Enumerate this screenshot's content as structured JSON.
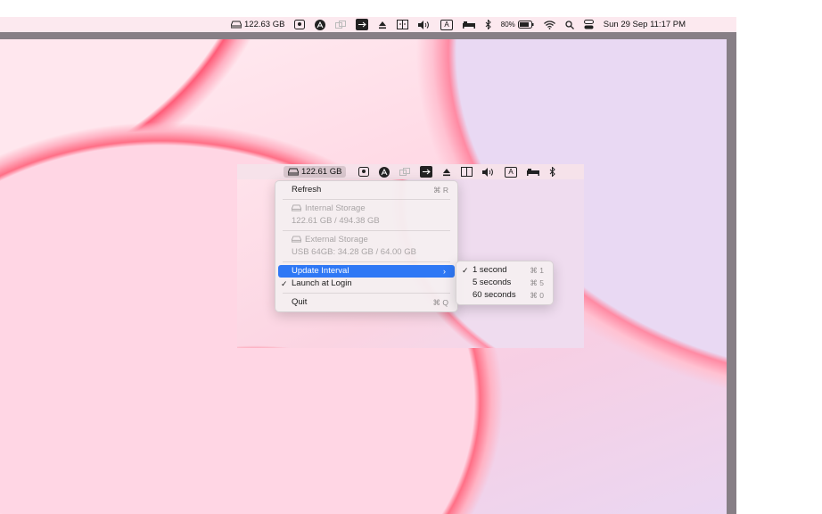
{
  "menubar": {
    "storage_label": "122.63 GB",
    "battery_percent": "80%",
    "datetime": "Sun 29 Sep  11:17 PM",
    "keyboard_letter": "A",
    "icons": [
      "disk-icon",
      "screenshot-icon",
      "app-store-icon",
      "dual-windows-icon",
      "usb-icon",
      "eject-icon",
      "display-mirror-icon",
      "volume-icon",
      "input-source-icon",
      "bed-icon",
      "bluetooth-icon",
      "battery-icon",
      "wifi-icon",
      "search-icon",
      "control-center-icon"
    ]
  },
  "inner_menubar": {
    "storage_label": "122.61 GB",
    "keyboard_letter": "A"
  },
  "menu": {
    "refresh_label": "Refresh",
    "refresh_shortcut": "⌘ R",
    "internal_header": "Internal Storage",
    "internal_value": "122.61 GB / 494.38 GB",
    "external_header": "External Storage",
    "external_value": "USB 64GB: 34.28 GB / 64.00 GB",
    "update_interval_label": "Update Interval",
    "launch_label": "Launch at Login",
    "launch_checked": "✓",
    "quit_label": "Quit",
    "quit_shortcut": "⌘ Q"
  },
  "submenu": {
    "items": [
      {
        "label": "1 second",
        "shortcut": "⌘ 1",
        "check": "✓"
      },
      {
        "label": "5 seconds",
        "shortcut": "⌘ 5",
        "check": ""
      },
      {
        "label": "60 seconds",
        "shortcut": "⌘ 0",
        "check": ""
      }
    ]
  },
  "colors": {
    "highlight": "#2f78f5",
    "frame": "#877f86"
  }
}
